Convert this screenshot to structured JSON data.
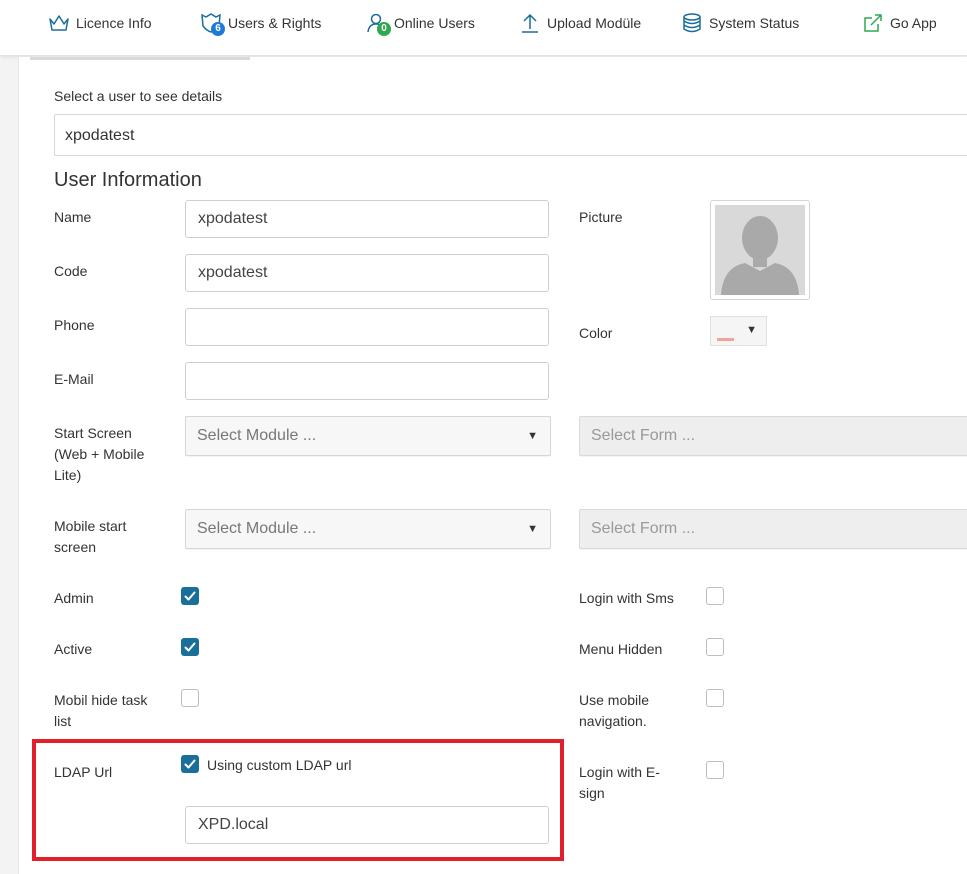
{
  "nav": {
    "licence": "Licence Info",
    "users": "Users & Rights",
    "users_badge": "6",
    "online": "Online Users",
    "online_badge": "0",
    "upload": "Upload Modüle",
    "status": "System Status",
    "goapp": "Go App"
  },
  "select_user": {
    "label": "Select a user to see details",
    "value": "xpodatest"
  },
  "user_info": {
    "heading": "User Information",
    "name_label": "Name",
    "name_value": "xpodatest",
    "code_label": "Code",
    "code_value": "xpodatest",
    "phone_label": "Phone",
    "phone_value": "",
    "email_label": "E-Mail",
    "email_value": "",
    "picture_label": "Picture",
    "color_label": "Color",
    "color_value": "#f4a29a",
    "start_screen_label": "Start Screen (Web + Mobile Lite)",
    "start_module_placeholder": "Select Module ...",
    "start_form_placeholder": "Select Form ...",
    "mobile_start_label": "Mobile start screen",
    "mobile_module_placeholder": "Select Module ...",
    "mobile_form_placeholder": "Select Form ...",
    "admin_label": "Admin",
    "admin_checked": true,
    "active_label": "Active",
    "active_checked": true,
    "mobil_hide_label": "Mobil hide task list",
    "mobil_hide_checked": false,
    "login_sms_label": "Login with Sms",
    "login_sms_checked": false,
    "menu_hidden_label": "Menu Hidden",
    "menu_hidden_checked": false,
    "mobile_nav_label": "Use mobile navigation.",
    "mobile_nav_checked": false,
    "login_esign_label": "Login with E-sign",
    "login_esign_checked": false,
    "ldap_label": "LDAP Url",
    "ldap_custom_label": "Using custom LDAP url",
    "ldap_custom_checked": true,
    "ldap_value": "XPD.local"
  },
  "colors": {
    "accent": "#1a6e9a",
    "highlight": "#e0202a",
    "badge_blue": "#1e7ad8",
    "badge_green": "#2fa84f"
  }
}
